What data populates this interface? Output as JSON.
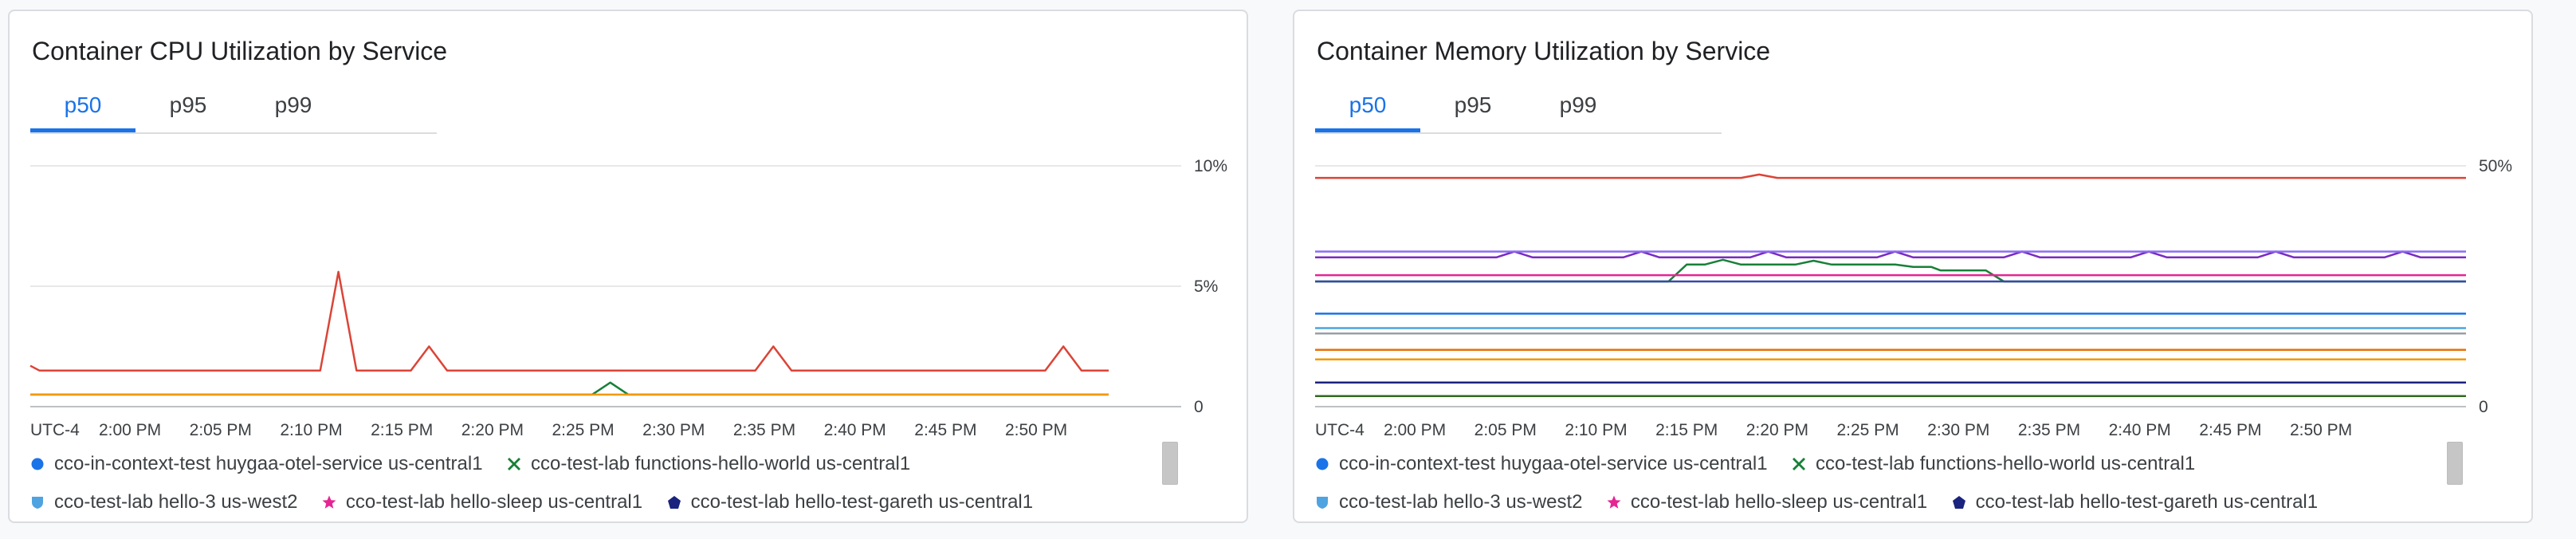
{
  "widgets": [
    {
      "id": "cpu",
      "title": "Container CPU Utilization by Service",
      "tabs": [
        {
          "label": "p50",
          "active": true
        },
        {
          "label": "p95",
          "active": false
        },
        {
          "label": "p99",
          "active": false
        }
      ],
      "legend": [
        {
          "label": "cco-in-context-test huygaa-otel-service us-central1",
          "icon": "circle-icon",
          "color": "#1a73e8"
        },
        {
          "label": "cco-test-lab functions-hello-world us-central1",
          "icon": "cross-icon",
          "color": "#188038"
        },
        {
          "label": "cco-test-lab hello-3 us-west2",
          "icon": "shield-icon",
          "color": "#4fa3e0"
        },
        {
          "label": "cco-test-lab hello-sleep us-central1",
          "icon": "star-icon",
          "color": "#e52592"
        },
        {
          "label": "cco-test-lab hello-test-gareth us-central1",
          "icon": "pentagon-icon",
          "color": "#1a237e"
        }
      ],
      "chart_data": {
        "type": "line",
        "timezone_label": "UTC-4",
        "x_tick_labels": [
          "2:00 PM",
          "2:05 PM",
          "2:10 PM",
          "2:15 PM",
          "2:20 PM",
          "2:25 PM",
          "2:30 PM",
          "2:35 PM",
          "2:40 PM",
          "2:45 PM",
          "2:50 PM"
        ],
        "x_range_minutes": [
          -5.5,
          58
        ],
        "y_tick_labels": [
          "10%",
          "5%",
          "0"
        ],
        "y_ticks": [
          10,
          5,
          0
        ],
        "ylim": [
          0,
          10
        ],
        "grid": true,
        "series": [
          {
            "color": "#db4437",
            "points": [
              [
                -5.5,
                1.7
              ],
              [
                -5,
                1.5
              ],
              [
                10.5,
                1.5
              ],
              [
                11.5,
                5.6
              ],
              [
                12.5,
                1.5
              ],
              [
                15.5,
                1.5
              ],
              [
                16.5,
                2.5
              ],
              [
                17.5,
                1.5
              ],
              [
                34.5,
                1.5
              ],
              [
                35.5,
                2.5
              ],
              [
                36.5,
                1.5
              ],
              [
                50.5,
                1.5
              ],
              [
                51.5,
                2.5
              ],
              [
                52.5,
                1.5
              ],
              [
                54,
                1.5
              ]
            ]
          },
          {
            "color": "#188038",
            "points": [
              [
                -5.5,
                0.5
              ],
              [
                25.5,
                0.5
              ],
              [
                26.5,
                1.0
              ],
              [
                27.5,
                0.5
              ],
              [
                54,
                0.5
              ]
            ]
          },
          {
            "color": "#f29900",
            "points": [
              [
                -5.5,
                0.5
              ],
              [
                54,
                0.5
              ]
            ]
          }
        ]
      }
    },
    {
      "id": "memory",
      "title": "Container Memory Utilization by Service",
      "tabs": [
        {
          "label": "p50",
          "active": true
        },
        {
          "label": "p95",
          "active": false
        },
        {
          "label": "p99",
          "active": false
        }
      ],
      "legend": [
        {
          "label": "cco-in-context-test huygaa-otel-service us-central1",
          "icon": "circle-icon",
          "color": "#1a73e8"
        },
        {
          "label": "cco-test-lab functions-hello-world us-central1",
          "icon": "cross-icon",
          "color": "#188038"
        },
        {
          "label": "cco-test-lab hello-3 us-west2",
          "icon": "shield-icon",
          "color": "#4fa3e0"
        },
        {
          "label": "cco-test-lab hello-sleep us-central1",
          "icon": "star-icon",
          "color": "#e52592"
        },
        {
          "label": "cco-test-lab hello-test-gareth us-central1",
          "icon": "pentagon-icon",
          "color": "#1a237e"
        }
      ],
      "chart_data": {
        "type": "line",
        "timezone_label": "UTC-4",
        "x_tick_labels": [
          "2:00 PM",
          "2:05 PM",
          "2:10 PM",
          "2:15 PM",
          "2:20 PM",
          "2:25 PM",
          "2:30 PM",
          "2:35 PM",
          "2:40 PM",
          "2:45 PM",
          "2:50 PM"
        ],
        "x_range_minutes": [
          -5.5,
          58
        ],
        "y_tick_labels": [
          "50%",
          "0"
        ],
        "y_ticks": [
          50,
          0
        ],
        "ylim": [
          0,
          50
        ],
        "grid": true,
        "series": [
          {
            "color": "#db4437",
            "points": [
              [
                -5.5,
                47.5
              ],
              [
                18,
                47.5
              ],
              [
                19,
                48.2
              ],
              [
                20,
                47.5
              ],
              [
                58,
                47.5
              ]
            ]
          },
          {
            "color": "#7b2cbf",
            "points": [
              [
                -5.5,
                31
              ],
              [
                4.5,
                31
              ],
              [
                5.5,
                32.2
              ],
              [
                6.5,
                31
              ],
              [
                11.5,
                31
              ],
              [
                12.5,
                32.2
              ],
              [
                13.5,
                31
              ],
              [
                18.5,
                31
              ],
              [
                19.5,
                32.2
              ],
              [
                20.5,
                31
              ],
              [
                25.5,
                31
              ],
              [
                26.5,
                32.2
              ],
              [
                27.5,
                31
              ],
              [
                32.5,
                31
              ],
              [
                33.5,
                32.2
              ],
              [
                34.5,
                31
              ],
              [
                39.5,
                31
              ],
              [
                40.5,
                32.2
              ],
              [
                41.5,
                31
              ],
              [
                46.5,
                31
              ],
              [
                47.5,
                32.2
              ],
              [
                48.5,
                31
              ],
              [
                53.5,
                31
              ],
              [
                54.5,
                32.2
              ],
              [
                55.5,
                31
              ],
              [
                58,
                31
              ]
            ]
          },
          {
            "color": "#8c6cf2",
            "points": [
              [
                -5.5,
                32.2
              ],
              [
                58,
                32.2
              ]
            ]
          },
          {
            "color": "#188038",
            "points": [
              [
                -5.5,
                26
              ],
              [
                14,
                26
              ],
              [
                15,
                29.5
              ],
              [
                16,
                29.5
              ],
              [
                17,
                30.5
              ],
              [
                18,
                29.5
              ],
              [
                21,
                29.5
              ],
              [
                22,
                30.3
              ],
              [
                23,
                29.5
              ],
              [
                26.5,
                29.5
              ],
              [
                27.5,
                29
              ],
              [
                28.5,
                29
              ],
              [
                29,
                28.3
              ],
              [
                31.5,
                28.3
              ],
              [
                32.5,
                26
              ],
              [
                58,
                26
              ]
            ]
          },
          {
            "color": "#e52592",
            "points": [
              [
                -5.5,
                27.3
              ],
              [
                58,
                27.3
              ]
            ]
          },
          {
            "color": "#3949ab",
            "points": [
              [
                -5.5,
                26
              ],
              [
                58,
                26
              ]
            ]
          },
          {
            "color": "#1a73e8",
            "points": [
              [
                -5.5,
                19.3
              ],
              [
                58,
                19.3
              ]
            ]
          },
          {
            "color": "#4fa3e0",
            "points": [
              [
                -5.5,
                16.3
              ],
              [
                58,
                16.3
              ]
            ]
          },
          {
            "color": "#9aa0a6",
            "points": [
              [
                -5.5,
                15.2
              ],
              [
                58,
                15.2
              ]
            ]
          },
          {
            "color": "#e8710a",
            "points": [
              [
                -5.5,
                11.8
              ],
              [
                58,
                11.8
              ]
            ]
          },
          {
            "color": "#f29900",
            "points": [
              [
                -5.5,
                9.8
              ],
              [
                58,
                9.8
              ]
            ]
          },
          {
            "color": "#1a237e",
            "points": [
              [
                -5.5,
                5.0
              ],
              [
                58,
                5.0
              ]
            ]
          },
          {
            "color": "#33691e",
            "points": [
              [
                -5.5,
                2.2
              ],
              [
                58,
                2.2
              ]
            ]
          }
        ]
      }
    }
  ]
}
